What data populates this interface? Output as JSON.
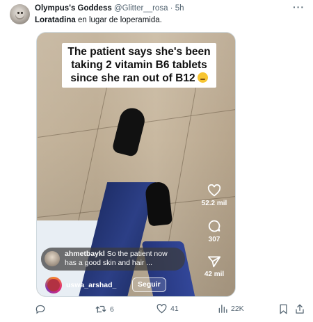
{
  "tweet": {
    "display_name": "Olympus's Goddess",
    "handle": "@Glitter__rosa",
    "separator": "·",
    "time": "5h",
    "more_label": "···",
    "text_bold": "Loratadina",
    "text_rest": " en lugar de loperamida."
  },
  "media": {
    "caption": "The patient says she's been taking 2 vitamin B6 tablets since she ran out of B12",
    "caption_emoji": "melting-face-emoji",
    "likes": "52.2 mil",
    "comments": "307",
    "shares": "42 mil",
    "comment_user": "ahmetbaykl",
    "comment_text": " So the patient now has a good skin and hair ...",
    "creator_handle": "uswa_arshad_",
    "follow_label": "Seguir"
  },
  "actions": {
    "reply_count": "",
    "retweet_count": "6",
    "like_count": "41",
    "views_count": "22K"
  },
  "colors": {
    "text_primary": "#0f1419",
    "text_secondary": "#536471",
    "border": "#cfd9de"
  }
}
